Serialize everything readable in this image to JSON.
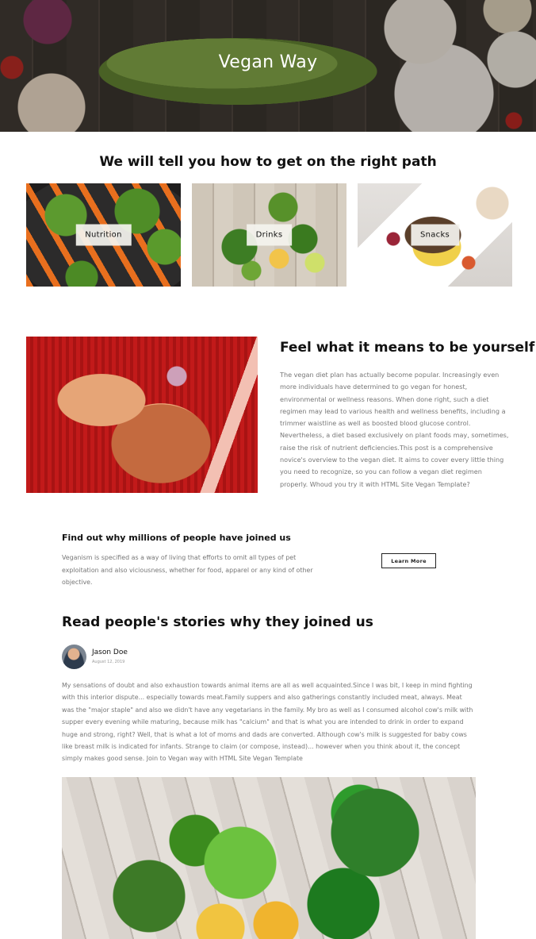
{
  "hero": {
    "title": "Vegan Way"
  },
  "path_section": {
    "heading": "We will tell you how to get on the right path",
    "categories": [
      {
        "label": "Nutrition"
      },
      {
        "label": "Drinks"
      },
      {
        "label": "Snacks"
      }
    ]
  },
  "feature": {
    "title": "Feel what it means to be yourself",
    "text": "The vegan diet plan has actually become popular. Increasingly even more individuals have determined to go vegan for honest, environmental or wellness reasons. When done right, such a diet regimen may lead to various health and wellness benefits, including a trimmer waistline as well as boosted blood glucose control. Nevertheless, a diet based exclusively on plant foods may, sometimes, raise the risk of nutrient deficiencies.This post is a comprehensive novice's overview to the vegan diet. It aims to cover every little thing you need to recognize, so you can follow a vegan diet regimen properly. Whoud you try it with HTML Site Vegan Template?"
  },
  "join": {
    "title": "Find out why millions of people have joined us",
    "text": "Veganism is specified as a way of living that efforts to omit all types of pet exploitation and also viciousness, whether for food, apparel or any kind of other objective.",
    "button_label": "Learn More"
  },
  "stories": {
    "title": "Read people's stories why they joined us",
    "author": {
      "name": "Jason Doe",
      "date": "August 12, 2019"
    },
    "text": "My sensations of doubt and also exhaustion towards animal items are all as well acquainted.Since I was bit, I keep in mind fighting with this interior dispute... especially towards meat.Family suppers and also gatherings constantly included meat, always. Meat was the \"major staple\" and also we didn't have any vegetarians in the family. My bro as well as I consumed alcohol cow's milk with supper every evening while maturing, because milk has \"calcium\" and that is what you are intended to drink in order to expand huge and strong, right? Well, that is what a lot of moms and dads are converted. Although cow's milk is suggested for baby cows like breast milk is indicated for infants. Strange to claim (or compose, instead)... however when you think about it, the concept simply makes good sense. Join to Vegan way with HTML Site Vegan Template"
  }
}
